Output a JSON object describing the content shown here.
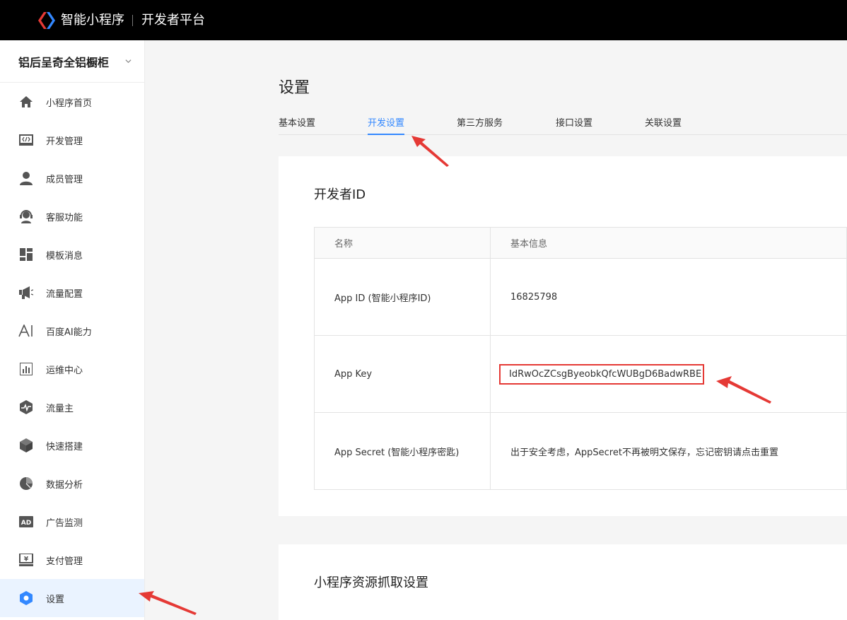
{
  "header": {
    "brand": "智能小程序",
    "subtitle": "开发者平台"
  },
  "sidebar": {
    "app_name": "铝后呈奇全铝橱柜",
    "items": [
      {
        "label": "小程序首页",
        "icon": "home-icon"
      },
      {
        "label": "开发管理",
        "icon": "code-icon"
      },
      {
        "label": "成员管理",
        "icon": "user-icon"
      },
      {
        "label": "客服功能",
        "icon": "headset-icon"
      },
      {
        "label": "模板消息",
        "icon": "template-icon"
      },
      {
        "label": "流量配置",
        "icon": "megaphone-icon"
      },
      {
        "label": "百度AI能力",
        "icon": "ai-icon"
      },
      {
        "label": "运维中心",
        "icon": "bar-chart-icon"
      },
      {
        "label": "流量主",
        "icon": "pulse-icon"
      },
      {
        "label": "快速搭建",
        "icon": "cube-icon"
      },
      {
        "label": "数据分析",
        "icon": "pie-chart-icon"
      },
      {
        "label": "广告监测",
        "icon": "ad-icon"
      },
      {
        "label": "支付管理",
        "icon": "payment-icon"
      },
      {
        "label": "设置",
        "icon": "settings-hexagon-icon",
        "active": true
      }
    ]
  },
  "main": {
    "title": "设置",
    "tabs": [
      {
        "label": "基本设置"
      },
      {
        "label": "开发设置",
        "active": true
      },
      {
        "label": "第三方服务"
      },
      {
        "label": "接口设置"
      },
      {
        "label": "关联设置"
      }
    ],
    "developer_card": {
      "title": "开发者ID",
      "columns": [
        "名称",
        "基本信息"
      ],
      "rows": [
        {
          "name": "App ID (智能小程序ID)",
          "value": "16825798"
        },
        {
          "name": "App Key",
          "value": "IdRwOcZCsgByeobkQfcWUBgD6BadwRBE"
        },
        {
          "name": "App Secret (智能小程序密匙)",
          "value": "出于安全考虑，AppSecret不再被明文保存，忘记密钥请点击重置"
        }
      ]
    },
    "resource_card": {
      "title": "小程序资源抓取设置"
    }
  },
  "colors": {
    "accent": "#3388ff",
    "active_bg": "#eaf3ff",
    "highlight": "#e53935"
  }
}
